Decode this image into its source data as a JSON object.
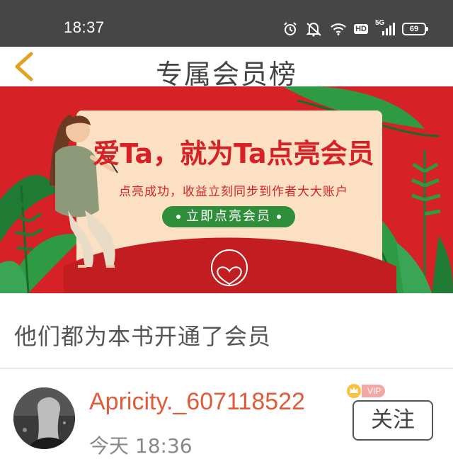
{
  "status_bar": {
    "time": "18:37",
    "icons": [
      "alarm-icon",
      "mute-icon",
      "wifi-icon",
      "hd-icon",
      "signal-5g-icon",
      "battery-icon"
    ],
    "hd_label": "HD",
    "network_label": "5G",
    "battery_level": "69"
  },
  "nav": {
    "title": "专属会员榜",
    "back_icon": "chevron-left-icon",
    "accent": "#e2a21f"
  },
  "banner": {
    "headline": "爱Ta，就为Ta点亮会员",
    "subline": "点亮成功，收益立刻同步到作者大大账户",
    "cta_label": "立即点亮会员",
    "background": "#d62226",
    "card_color": "#fbe0c4",
    "button_color": "#2f8e3a"
  },
  "section": {
    "title": "他们都为本书开通了会员"
  },
  "members": [
    {
      "username": "Apricity._607118522",
      "badge": "VIP",
      "time": "今天 18:36",
      "follow_label": "关注",
      "name_color": "#e05b3a"
    }
  ]
}
